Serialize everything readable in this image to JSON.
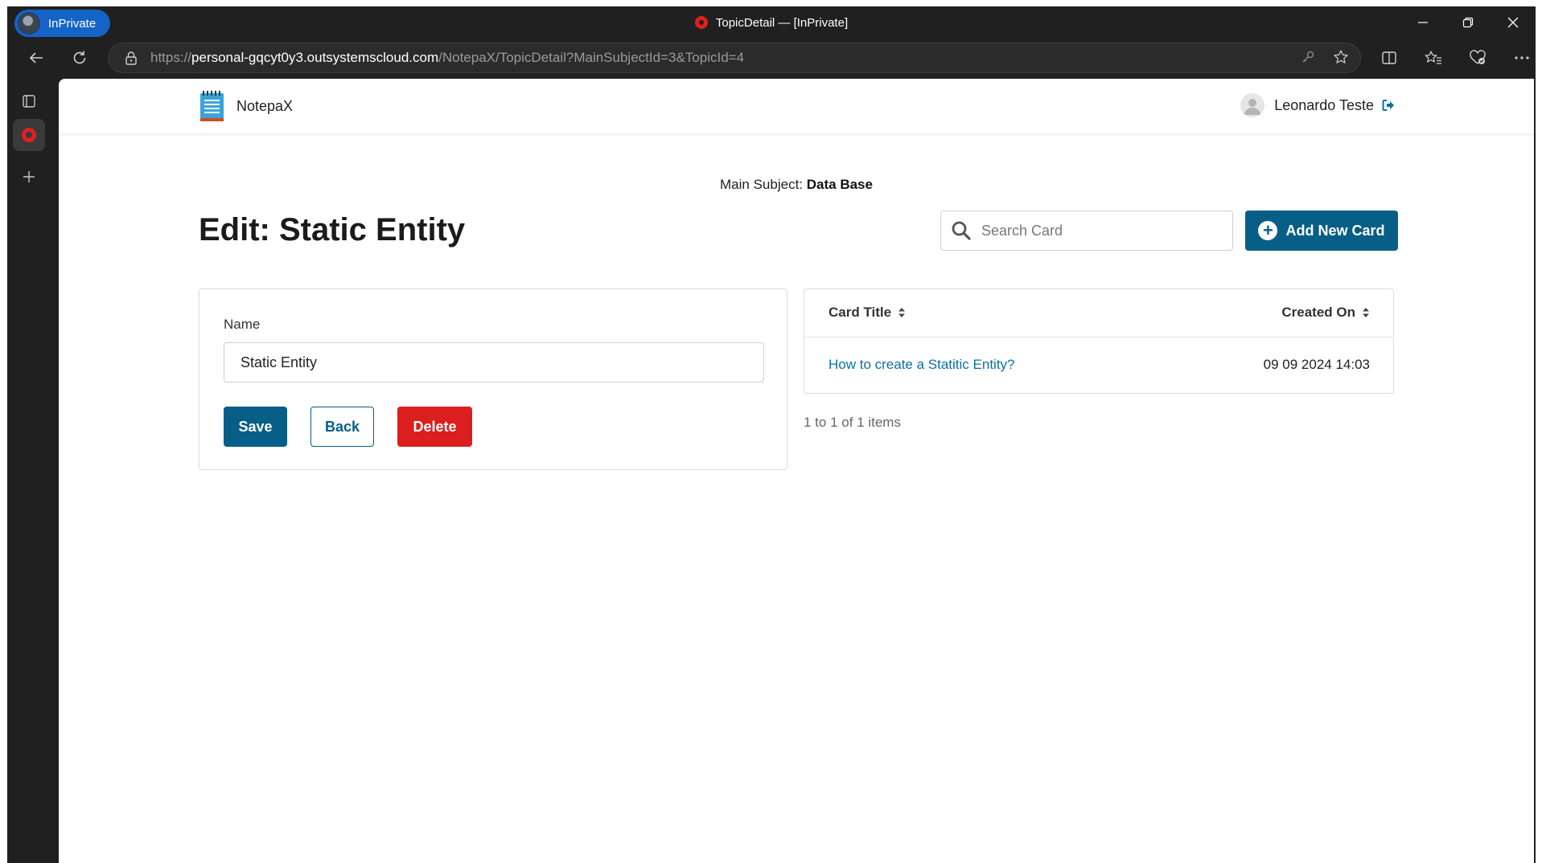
{
  "browser": {
    "inprivate_label": "InPrivate",
    "tab_title": "TopicDetail — [InPrivate]",
    "url_prefix": "https://",
    "url_host": "personal-gqcyt0y3.outsystemscloud.com",
    "url_path": "/NotepaX/TopicDetail?MainSubjectId=3&TopicId=4"
  },
  "app": {
    "name": "NotepaX",
    "user_name": "Leonardo Teste"
  },
  "page": {
    "main_subject_label": "Main Subject:",
    "main_subject_value": "Data Base",
    "title": "Edit: Static Entity",
    "search_placeholder": "Search Card",
    "add_button_label": "Add New Card"
  },
  "form": {
    "name_label": "Name",
    "name_value": "Static Entity",
    "save_label": "Save",
    "back_label": "Back",
    "delete_label": "Delete"
  },
  "table": {
    "columns": [
      "Card Title",
      "Created On"
    ],
    "rows": [
      {
        "title": "How to create a Statitic Entity?",
        "created_on": "09 09 2024 14:03"
      }
    ],
    "pagination": "1 to 1 of 1 items"
  },
  "colors": {
    "primary": "#075e86",
    "danger": "#db1e1e",
    "link": "#0d6fa0",
    "browser_chrome": "#202020"
  }
}
